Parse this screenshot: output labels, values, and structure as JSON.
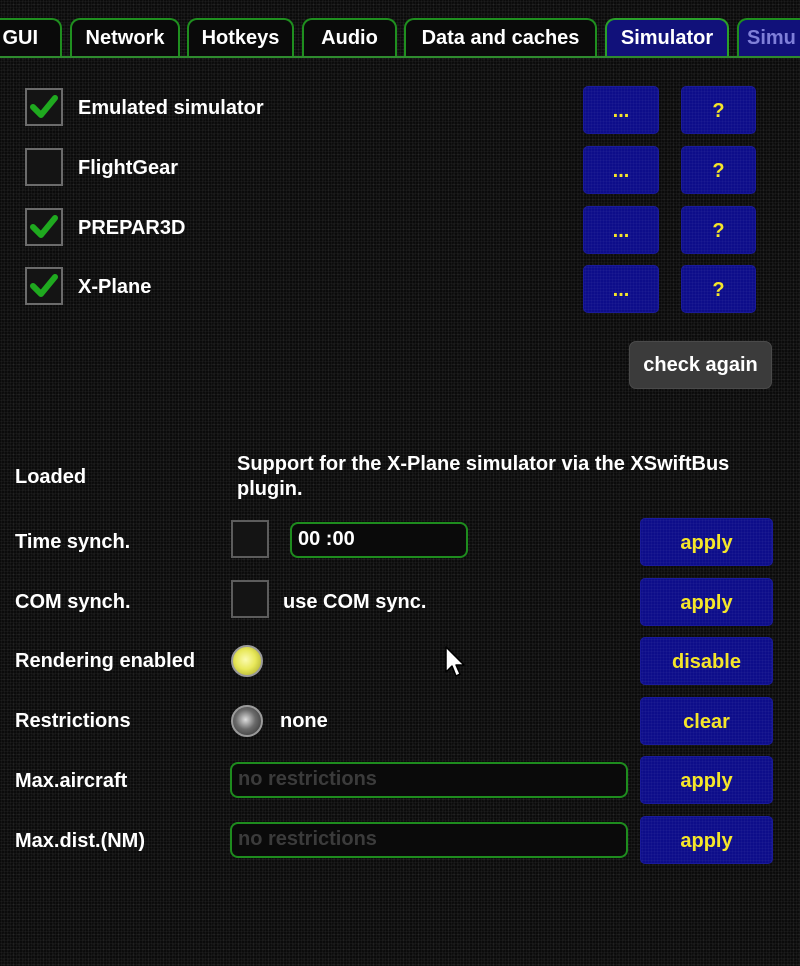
{
  "tabs": [
    {
      "label": "GUI",
      "active": false
    },
    {
      "label": "Network",
      "active": false
    },
    {
      "label": "Hotkeys",
      "active": false
    },
    {
      "label": "Audio",
      "active": false
    },
    {
      "label": "Data and caches",
      "active": false
    },
    {
      "label": "Simulator",
      "active": true
    },
    {
      "label": "Simu",
      "active": false
    }
  ],
  "simulators": [
    {
      "name": "Emulated simulator",
      "checked": true,
      "settings_label": "...",
      "help_label": "?"
    },
    {
      "name": "FlightGear",
      "checked": false,
      "settings_label": "...",
      "help_label": "?"
    },
    {
      "name": "PREPAR3D",
      "checked": true,
      "settings_label": "...",
      "help_label": "?"
    },
    {
      "name": "X-Plane",
      "checked": true,
      "settings_label": "...",
      "help_label": "?"
    }
  ],
  "check_again_label": "check again",
  "status": {
    "loaded_label": "Loaded",
    "description": "Support for the X-Plane simulator via the XSwiftBus plugin."
  },
  "time_sync": {
    "label": "Time synch.",
    "checked": false,
    "value": "00 :00",
    "button": "apply"
  },
  "com_sync": {
    "label": "COM synch.",
    "checked": false,
    "option_label": "use COM sync.",
    "button": "apply"
  },
  "rendering": {
    "label": "Rendering enabled",
    "state": "on",
    "button": "disable"
  },
  "restrictions": {
    "label": "Restrictions",
    "state": "off",
    "value": "none",
    "button": "clear"
  },
  "max_aircraft": {
    "label": "Max.aircraft",
    "placeholder": "no restrictions",
    "button": "apply"
  },
  "max_dist": {
    "label": "Max.dist.(NM)",
    "placeholder": "no restrictions",
    "button": "apply"
  },
  "colors": {
    "button_bg": "#0d0d8a",
    "button_text": "#f5e62a",
    "border_green": "#1e8c1e"
  }
}
